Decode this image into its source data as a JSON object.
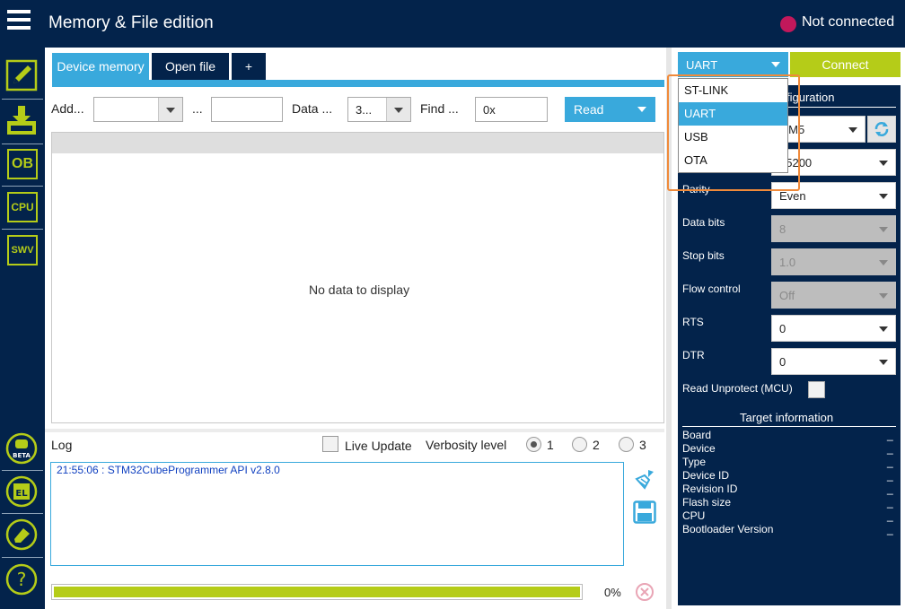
{
  "header": {
    "title": "Memory & File edition",
    "connection_status": "Not connected",
    "status_color": "#c2185b"
  },
  "sidebar": {
    "items": [
      {
        "name": "edit-icon",
        "label": ""
      },
      {
        "name": "download-icon",
        "label": ""
      },
      {
        "name": "ob-icon",
        "label": "OB"
      },
      {
        "name": "cpu-icon",
        "label": "CPU"
      },
      {
        "name": "swv-icon",
        "label": "SWV"
      },
      {
        "name": "beta-icon",
        "label": "BETA"
      },
      {
        "name": "el-icon",
        "label": "EL"
      },
      {
        "name": "eraser-icon",
        "label": ""
      },
      {
        "name": "help-icon",
        "label": "?"
      }
    ]
  },
  "tabs": {
    "device_memory": "Device memory",
    "open_file": "Open file",
    "add": "+"
  },
  "controls": {
    "address_label": "Add...",
    "size_separator": "...",
    "data_width_label": "Data ...",
    "data_width_value": "3...",
    "find_label": "Find ...",
    "find_value": "0x",
    "read_label": "Read"
  },
  "data_view": {
    "empty_text": "No data to display"
  },
  "log": {
    "label": "Log",
    "live_update": "Live Update",
    "verbosity_label": "Verbosity level",
    "verbosity_options": [
      "1",
      "2",
      "3"
    ],
    "verbosity_selected": "1",
    "lines": [
      "21:55:06 : STM32CubeProgrammer API v2.8.0"
    ],
    "progress_percent": 100,
    "progress_text": "0%"
  },
  "right_panel": {
    "interface_value": "UART",
    "connect_label": "Connect",
    "config_title": "figuration",
    "port_value": "OM5",
    "baudrate_value": "15200",
    "fields": {
      "parity": {
        "label": "Parity",
        "value": "Even"
      },
      "data_bits": {
        "label": "Data bits",
        "value": "8"
      },
      "stop_bits": {
        "label": "Stop bits",
        "value": "1.0"
      },
      "flow_control": {
        "label": "Flow control",
        "value": "Off"
      },
      "rts": {
        "label": "RTS",
        "value": "0"
      },
      "dtr": {
        "label": "DTR",
        "value": "0"
      }
    },
    "read_unprotect_label": "Read Unprotect (MCU)",
    "target_info_title": "Target information",
    "target_info": [
      {
        "label": "Board",
        "value": "_"
      },
      {
        "label": "Device",
        "value": "_"
      },
      {
        "label": "Type",
        "value": "_"
      },
      {
        "label": "Device ID",
        "value": "_"
      },
      {
        "label": "Revision ID",
        "value": "_"
      },
      {
        "label": "Flash size",
        "value": "_"
      },
      {
        "label": "CPU",
        "value": "_"
      },
      {
        "label": "Bootloader Version",
        "value": "_"
      }
    ]
  },
  "interface_dropdown": {
    "options": [
      "ST-LINK",
      "UART",
      "USB",
      "OTA"
    ],
    "selected": "UART"
  },
  "colors": {
    "navy": "#03234b",
    "accent_blue": "#39a9dc",
    "accent_green": "#b5cc18",
    "highlight_orange": "#f08a3a"
  }
}
